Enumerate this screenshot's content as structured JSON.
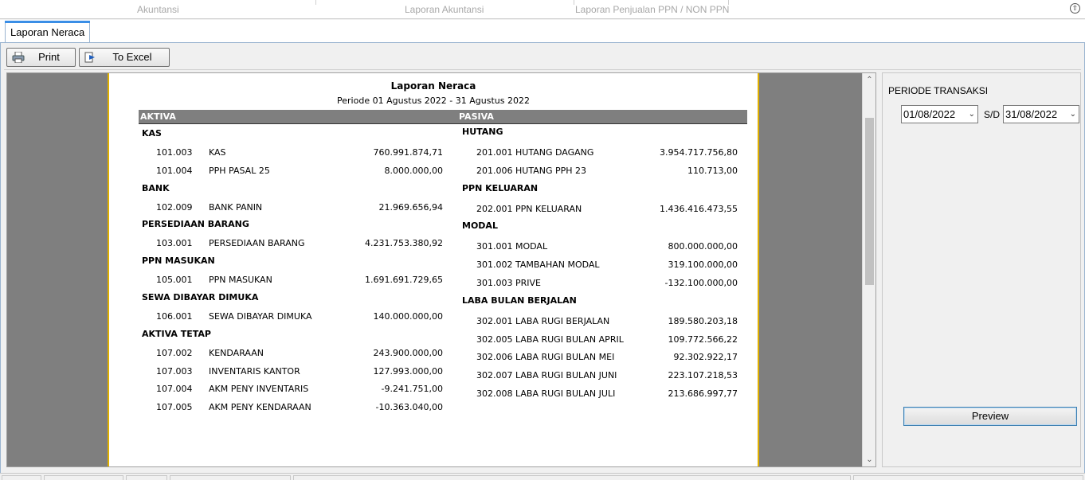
{
  "topbar": {
    "tabs": [
      "Akuntansi",
      "Laporan Akuntansi",
      "Laporan Penjualan PPN / NON PPN"
    ]
  },
  "tab": {
    "label": "Laporan Neraca"
  },
  "toolbar": {
    "print_label": "Print",
    "excel_label": "To Excel"
  },
  "report": {
    "title": "Laporan Neraca",
    "period": "Periode 01 Agustus 2022 - 31 Agustus 2022",
    "col_aktiva": "AKTIVA",
    "col_pasiva": "PASIVA",
    "aktiva": [
      {
        "group": "KAS",
        "rows": [
          {
            "code": "101.003",
            "name": "KAS",
            "amount": "760.991.874,71"
          },
          {
            "code": "101.004",
            "name": "PPH PASAL 25",
            "amount": "8.000.000,00"
          }
        ]
      },
      {
        "group": "BANK",
        "rows": [
          {
            "code": "102.009",
            "name": "BANK PANIN",
            "amount": "21.969.656,94"
          }
        ]
      },
      {
        "group": "PERSEDIAAN BARANG",
        "rows": [
          {
            "code": "103.001",
            "name": "PERSEDIAAN BARANG",
            "amount": "4.231.753.380,92"
          }
        ]
      },
      {
        "group": "PPN MASUKAN",
        "rows": [
          {
            "code": "105.001",
            "name": "PPN MASUKAN",
            "amount": "1.691.691.729,65"
          }
        ]
      },
      {
        "group": "SEWA DIBAYAR DIMUKA",
        "rows": [
          {
            "code": "106.001",
            "name": "SEWA DIBAYAR DIMUKA",
            "amount": "140.000.000,00"
          }
        ]
      },
      {
        "group": "AKTIVA TETAP",
        "rows": [
          {
            "code": "107.002",
            "name": "KENDARAAN",
            "amount": "243.900.000,00"
          },
          {
            "code": "107.003",
            "name": "INVENTARIS KANTOR",
            "amount": "127.993.000,00"
          },
          {
            "code": "107.004",
            "name": "AKM PENY INVENTARIS",
            "amount": "-9.241.751,00"
          },
          {
            "code": "107.005",
            "name": "AKM PENY KENDARAAN",
            "amount": "-10.363.040,00"
          }
        ]
      }
    ],
    "pasiva": [
      {
        "group": "HUTANG",
        "rows": [
          {
            "code": "201.001",
            "name": "HUTANG DAGANG",
            "amount": "3.954.717.756,80"
          },
          {
            "code": "201.006",
            "name": "HUTANG PPH 23",
            "amount": "110.713,00"
          }
        ]
      },
      {
        "group": "PPN KELUARAN",
        "rows": [
          {
            "code": "202.001",
            "name": "PPN KELUARAN",
            "amount": "1.436.416.473,55"
          }
        ]
      },
      {
        "group": "MODAL",
        "rows": [
          {
            "code": "301.001",
            "name": "MODAL",
            "amount": "800.000.000,00"
          },
          {
            "code": "301.002",
            "name": "TAMBAHAN MODAL",
            "amount": "319.100.000,00"
          },
          {
            "code": "301.003",
            "name": "PRIVE",
            "amount": "-132.100.000,00"
          }
        ]
      },
      {
        "group": "LABA BULAN BERJALAN",
        "rows": [
          {
            "code": "302.001",
            "name": "LABA RUGI BERJALAN",
            "amount": "189.580.203,18"
          },
          {
            "code": "302.005",
            "name": "LABA RUGI BULAN APRIL",
            "amount": "109.772.566,22"
          },
          {
            "code": "302.006",
            "name": "LABA RUGI BULAN MEI",
            "amount": "92.302.922,17"
          },
          {
            "code": "302.007",
            "name": "LABA RUGI BULAN JUNI",
            "amount": "223.107.218,53"
          },
          {
            "code": "302.008",
            "name": "LABA RUGI BULAN JULI",
            "amount": "213.686.997,77"
          }
        ]
      }
    ]
  },
  "side": {
    "periode_label": "PERIODE TRANSAKSI",
    "date_from": "01/08/2022",
    "sd_label": "S/D",
    "date_to": "31/08/2022",
    "preview_label": "Preview"
  },
  "icons": {
    "print": "printer-icon",
    "excel": "export-arrow-icon",
    "up": "chevron-up-icon"
  }
}
